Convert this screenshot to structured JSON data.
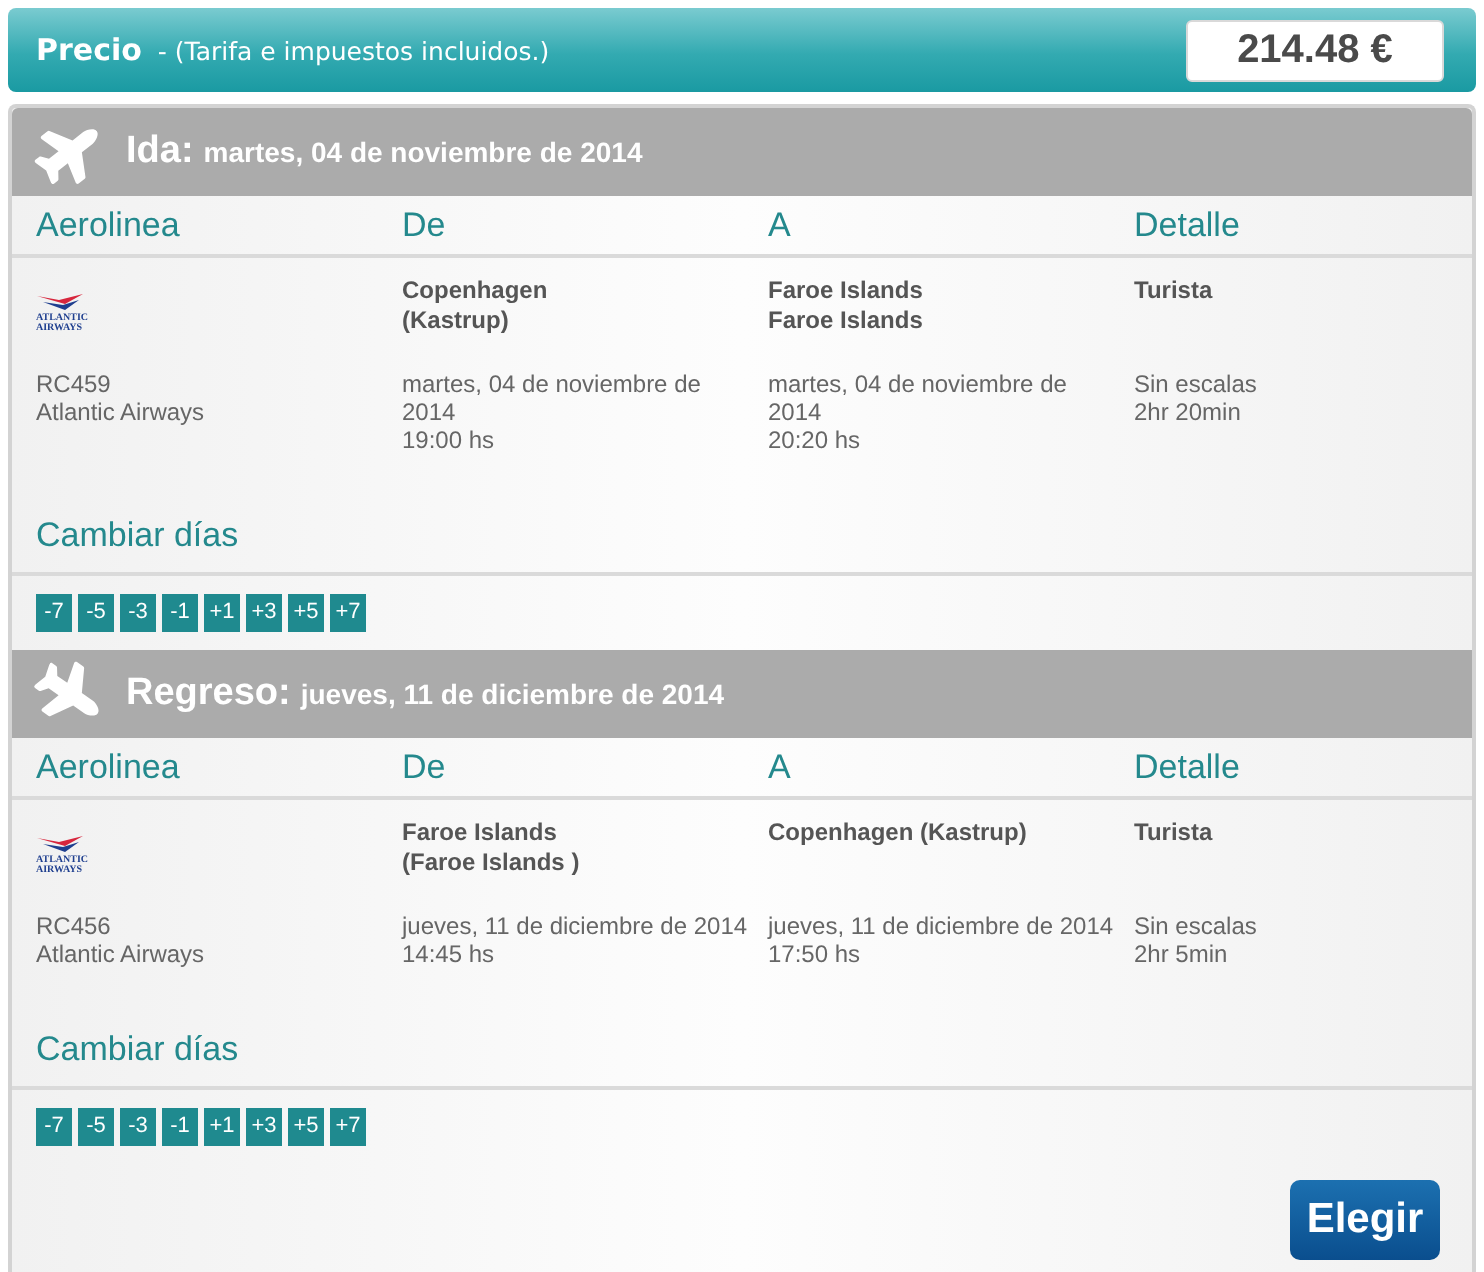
{
  "price_bar": {
    "title": "Precio",
    "note": "- (Tarifa e impuestos incluidos.)",
    "total": "214.48 €"
  },
  "legs": [
    {
      "kind": "outbound",
      "label": "Ida:",
      "date": "martes, 04 de noviembre de 2014",
      "columns": [
        "Aerolinea",
        "De",
        "A",
        "Detalle"
      ],
      "flight": {
        "logo_text": "ATLANTIC AIRWAYS",
        "number": "RC459",
        "airline": "Atlantic Airways",
        "from_lines": [
          "Copenhagen",
          "(Kastrup)"
        ],
        "to_lines": [
          "Faroe Islands",
          "Faroe Islands"
        ],
        "cabin": "Turista",
        "departure_date_lines": [
          "martes, 04 de noviembre de",
          "2014"
        ],
        "departure_time": "19:00 hs",
        "arrival_date_lines": [
          "martes, 04 de noviembre de",
          "2014"
        ],
        "arrival_time": "20:20 hs",
        "stops": "Sin escalas",
        "duration": "2hr 20min"
      },
      "change_days": {
        "label": "Cambiar días",
        "options": [
          "-7",
          "-5",
          "-3",
          "-1",
          "+1",
          "+3",
          "+5",
          "+7"
        ]
      }
    },
    {
      "kind": "return",
      "label": "Regreso:",
      "date": "jueves, 11 de diciembre de 2014",
      "columns": [
        "Aerolinea",
        "De",
        "A",
        "Detalle"
      ],
      "flight": {
        "logo_text": "ATLANTIC AIRWAYS",
        "number": "RC456",
        "airline": "Atlantic Airways",
        "from_lines": [
          "Faroe Islands",
          "(Faroe Islands )"
        ],
        "to_lines": [
          "Copenhagen (Kastrup)"
        ],
        "cabin": "Turista",
        "departure_date_lines": [
          "jueves, 11 de diciembre de 2014"
        ],
        "departure_time": "14:45 hs",
        "arrival_date_lines": [
          "jueves, 11 de diciembre de 2014"
        ],
        "arrival_time": "17:50 hs",
        "stops": "Sin escalas",
        "duration": "2hr 5min"
      },
      "change_days": {
        "label": "Cambiar días",
        "options": [
          "-7",
          "-5",
          "-3",
          "-1",
          "+1",
          "+3",
          "+5",
          "+7"
        ]
      }
    }
  ],
  "select_button": "Elegir"
}
